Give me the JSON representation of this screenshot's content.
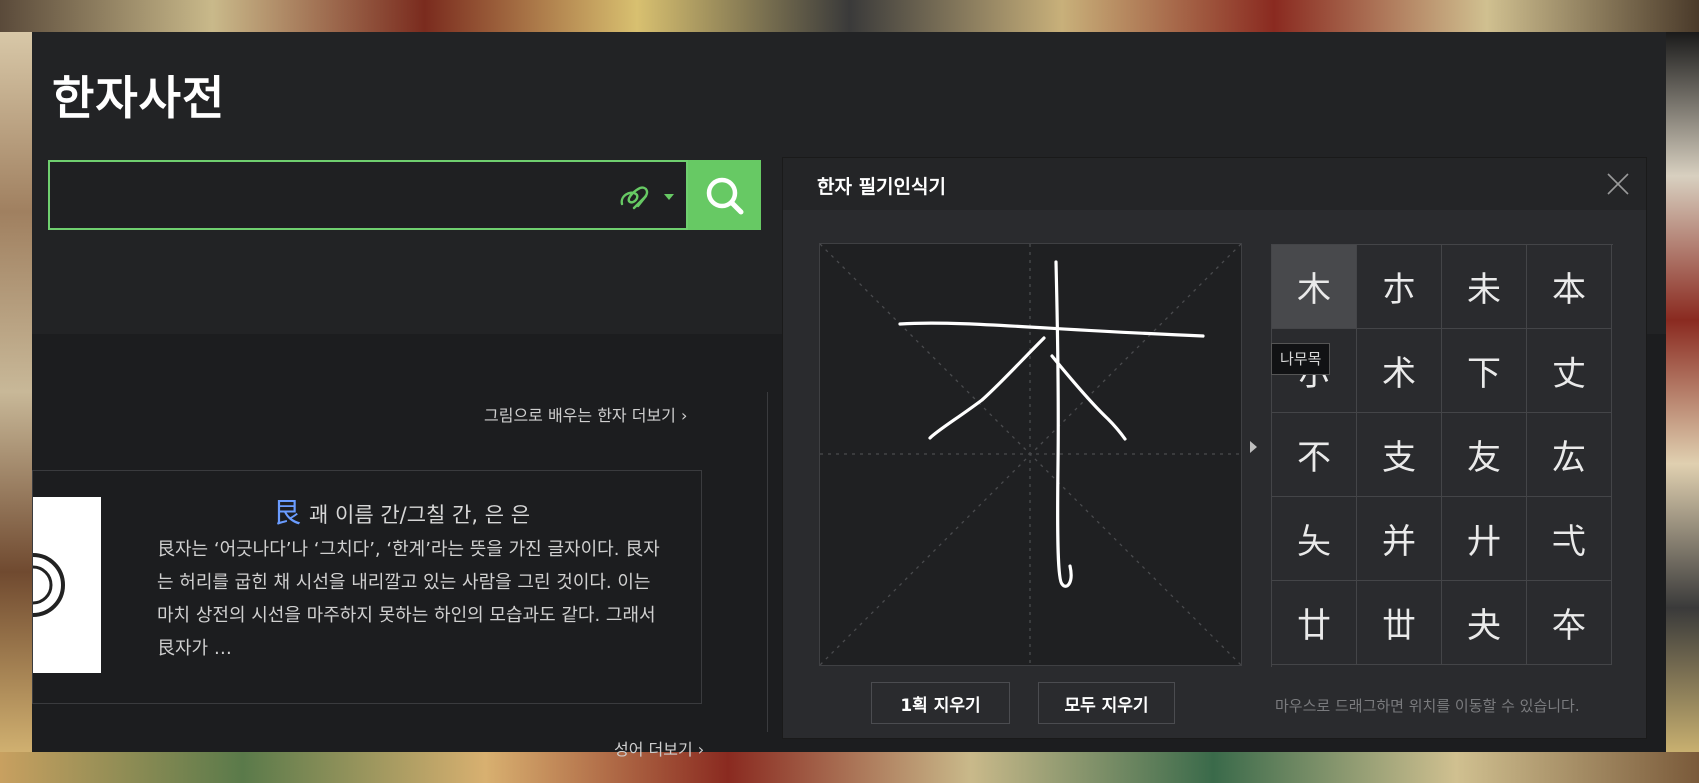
{
  "header": {
    "title": "한자사전"
  },
  "search": {
    "value": "",
    "placeholder": "",
    "handwriting_icon": "handwriting-pen-icon",
    "search_icon": "magnifier-icon"
  },
  "featured": {
    "more_link": "그림으로 배우는 한자 더보기",
    "char": "艮",
    "headline": "괘 이름 간/그칠 간, 은 은",
    "body": "艮자는 ‘어긋나다’나 ‘그치다’, ‘한계’라는 뜻을 가진 글자이다. 艮자는 허리를 굽힌 채 시선을 내리깔고 있는 사람을 그린 것이다. 이는 마치 상전의 시선을 마주하지 못하는 하인의 모습과도 같다. 그래서 艮자가 …"
  },
  "idioms": {
    "more_link": "성어 더보기"
  },
  "handwriting": {
    "title": "한자 필기인식기",
    "candidates": [
      "木",
      "朩",
      "未",
      "本",
      "朩",
      "术",
      "下",
      "丈",
      "不",
      "支",
      "友",
      "厷",
      "夨",
      "并",
      "廾",
      "弌",
      "廿",
      "丗",
      "夬",
      "夲"
    ],
    "selected_index": 0,
    "tooltip": "나무목",
    "clear_one_label": "1획 지우기",
    "clear_all_label": "모두 지우기",
    "hint": "마우스로 드래그하면 위치를 이동할 수 있습니다."
  },
  "colors": {
    "accent_green": "#67c964",
    "panel_bg": "#2a2b2e",
    "link_blue": "#6a9cff"
  }
}
